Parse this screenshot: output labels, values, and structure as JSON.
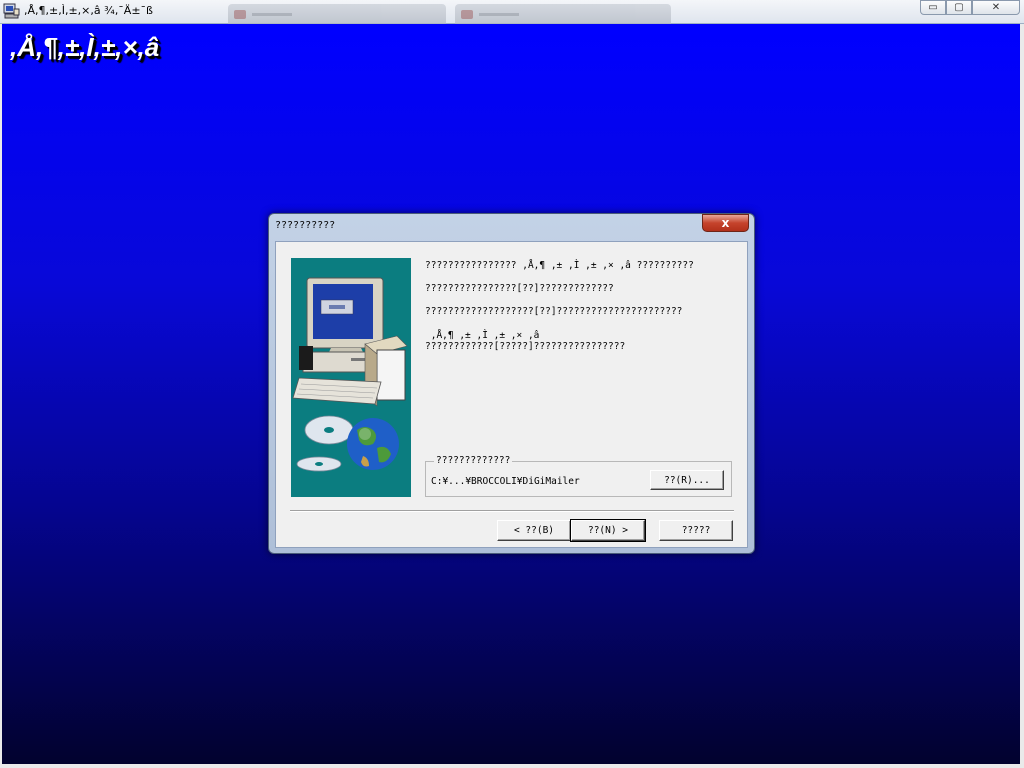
{
  "window": {
    "title": ",Å,¶,±,Ì,±,×,â ¾‚¯Ä±¯ß",
    "minimize_glyph": "▭",
    "maximize_glyph": "▢",
    "close_glyph": "✕"
  },
  "background": {
    "title": ",Å,¶,±,Ì,±,×,â"
  },
  "dialog": {
    "title": "??????????",
    "close_glyph": "x",
    "messages": [
      "???????????????? ,Å,¶ ,± ,Ì ,± ,× ,â ??????????",
      "????????????????[??]?????????????",
      "???????????????????[??]??????????????????????",
      " ,Å,¶ ,± ,Ì ,± ,× ,â",
      "????????????[?????]????????????????"
    ],
    "dest_group": {
      "legend": "?????????????",
      "path": "C:¥...¥BROCCOLI¥DiGiMailer",
      "browse_label": "??(R)..."
    },
    "buttons": {
      "back": "< ??(B)",
      "next": "??(N) >",
      "cancel": "?????"
    }
  },
  "colors": {
    "bg_top": "#0000ff",
    "bg_bottom": "#02022e",
    "illustration_bg": "#0b7d80"
  }
}
